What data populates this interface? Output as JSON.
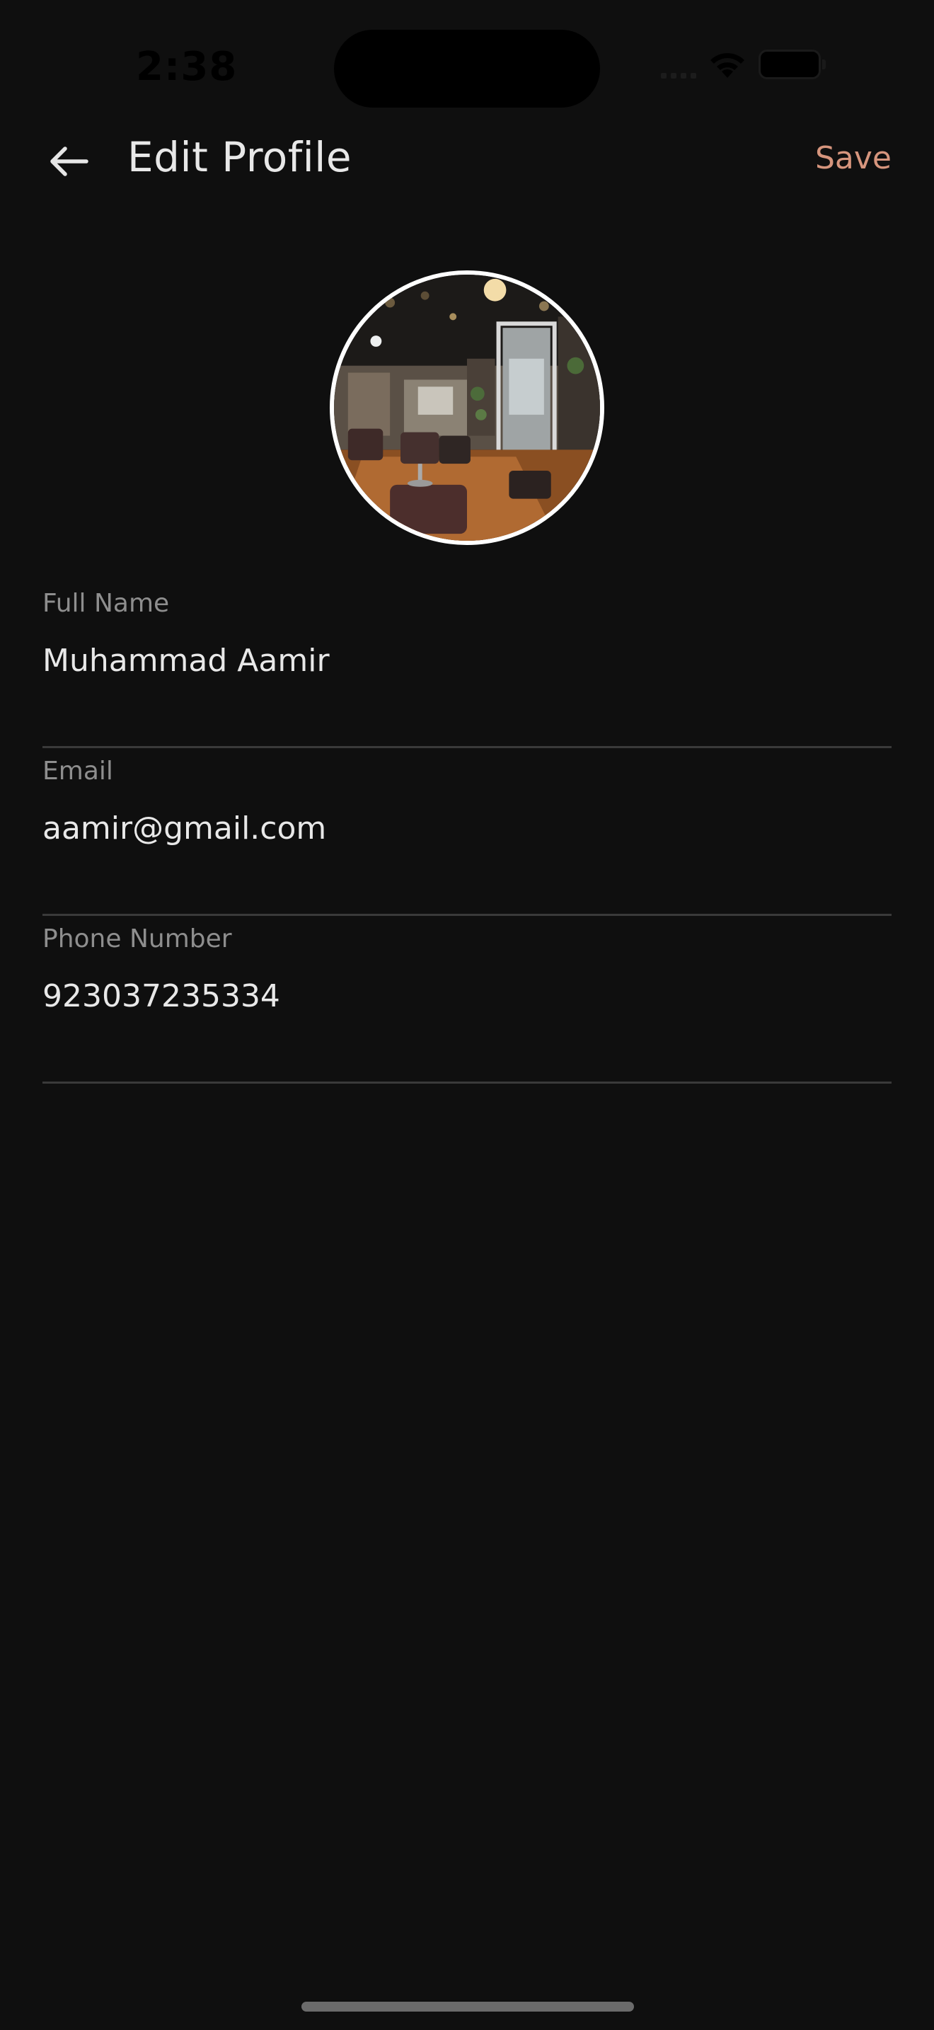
{
  "status_bar": {
    "time": "2:38"
  },
  "header": {
    "title": "Edit Profile",
    "save_label": "Save",
    "back_icon": "arrow-left-icon"
  },
  "avatar": {
    "description_icon": "salon-photo"
  },
  "form": {
    "full_name": {
      "label": "Full Name",
      "value": "Muhammad Aamir"
    },
    "email": {
      "label": "Email",
      "value": "aamir@gmail.com"
    },
    "phone": {
      "label": "Phone Number",
      "value": "923037235334"
    }
  },
  "colors": {
    "background": "#0f0f0f",
    "accent": "#d6957d",
    "label": "#8e8e8e",
    "text": "#e8e8e8",
    "divider": "#3a3a3a"
  }
}
